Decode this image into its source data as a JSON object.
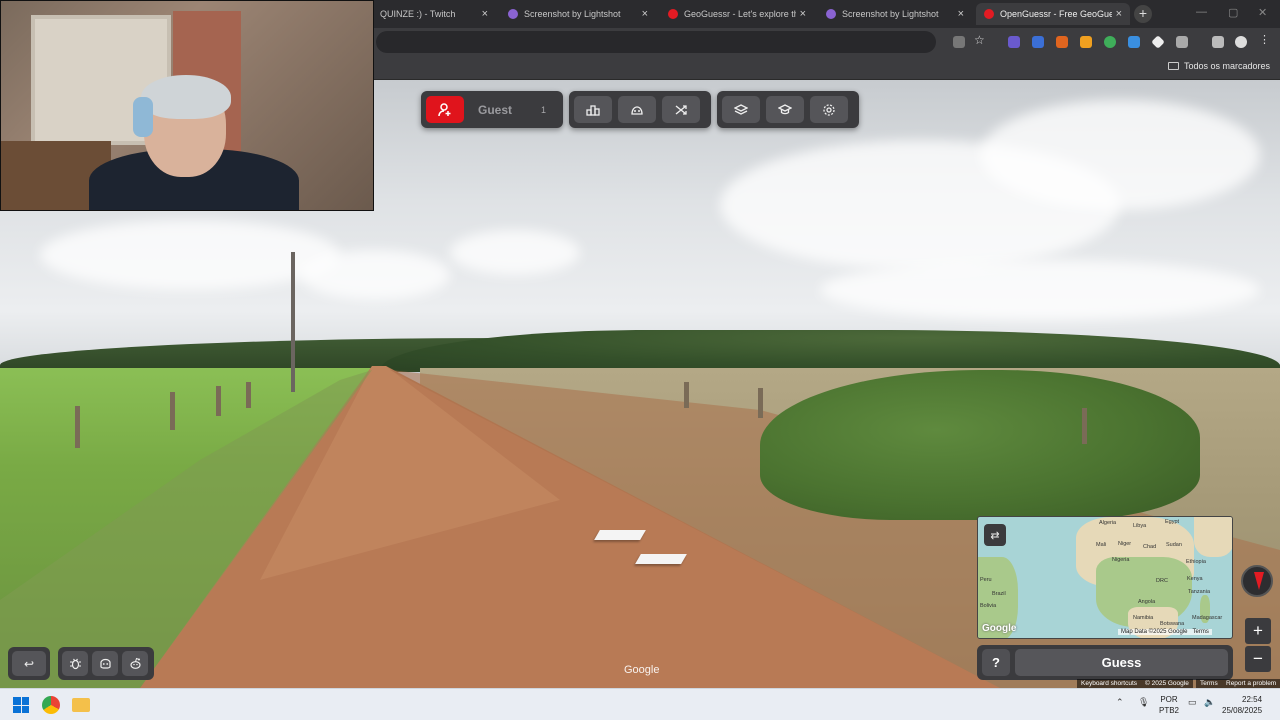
{
  "browser": {
    "tabs": [
      {
        "label": "QUINZE :) - Twitch",
        "close": "×",
        "icon_color": "#9146ff",
        "active": false
      },
      {
        "label": "Screenshot by Lightshot",
        "close": "×",
        "icon_color": "#8a63d2",
        "active": false
      },
      {
        "label": "GeoGuessr - Let's explore the w",
        "close": "×",
        "icon_color": "#e31b23",
        "active": false
      },
      {
        "label": "Screenshot by Lightshot",
        "close": "×",
        "icon_color": "#8a63d2",
        "active": false
      },
      {
        "label": "OpenGuessr - Free GeoGuessr",
        "close": "×",
        "icon_color": "#e31b23",
        "active": true
      }
    ],
    "new_tab": "+",
    "bookmarks_all": "Todos os marcadores"
  },
  "game_menu": {
    "player_name": "Guest",
    "player_count": "1",
    "icons": [
      "add-user-icon",
      "leaderboard-icon",
      "multiplayer-icon",
      "random-icon",
      "layers-icon",
      "learn-icon",
      "settings-icon"
    ]
  },
  "bottom_controls": {
    "back_icon": "undo-icon",
    "icons": [
      "bug-icon",
      "discord-icon",
      "reddit-icon"
    ]
  },
  "map": {
    "labels": [
      "Algeria",
      "Libya",
      "Egypt",
      "Mali",
      "Niger",
      "Chad",
      "Sudan",
      "Nigeria",
      "Ethiopia",
      "DRC",
      "Kenya",
      "Tanzania",
      "Angola",
      "Namibia",
      "Botswana",
      "Madagascar",
      "Brazil",
      "Peru",
      "Bolivia"
    ],
    "attribution": "Map Data ©2025 Google",
    "terms": "Terms",
    "google": "Google"
  },
  "guess": {
    "help_label": "?",
    "button_label": "Guess"
  },
  "zoom": {
    "plus": "+",
    "minus": "−"
  },
  "street_view": {
    "watermark": "Google",
    "footer": {
      "keyboard": "Keyboard shortcuts",
      "data": "© 2025 Google",
      "terms": "Terms",
      "report": "Report a problem"
    }
  },
  "taskbar": {
    "lang_top": "POR",
    "lang_bottom": "PTB2",
    "time": "22:54",
    "date": "25/08/2025"
  },
  "colors": {
    "accent_red": "#e0141c",
    "panel": "#3b3b3e"
  }
}
